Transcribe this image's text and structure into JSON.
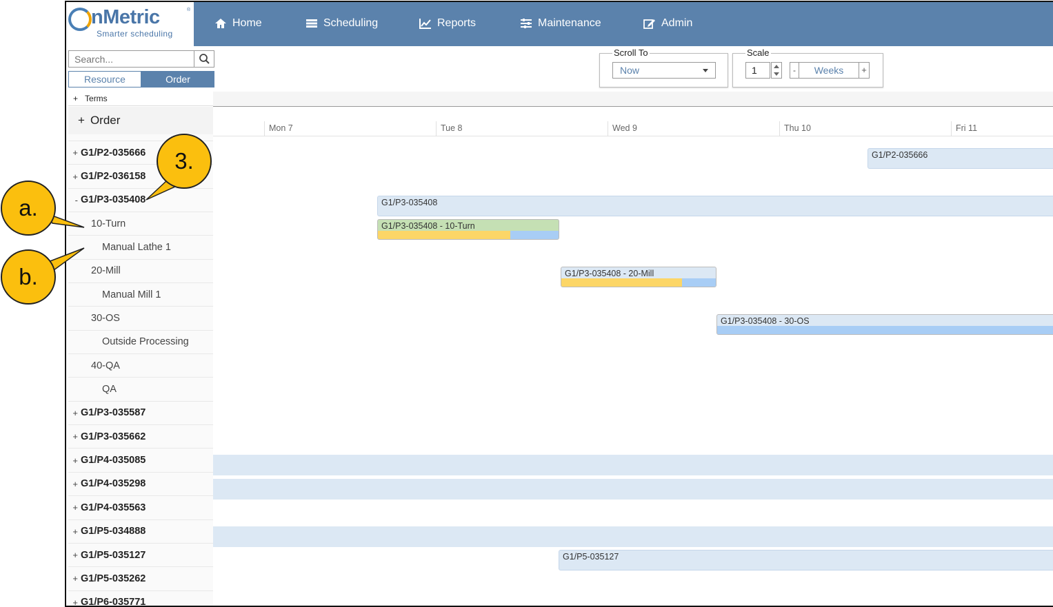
{
  "brand": {
    "name": "nMetric",
    "tagline": "Smarter scheduling",
    "reg": "®"
  },
  "nav": [
    {
      "label": "Home",
      "icon": "home-icon"
    },
    {
      "label": "Scheduling",
      "icon": "calendar-icon"
    },
    {
      "label": "Reports",
      "icon": "chart-icon"
    },
    {
      "label": "Maintenance",
      "icon": "sliders-icon"
    },
    {
      "label": "Admin",
      "icon": "edit-icon"
    }
  ],
  "sidebar": {
    "search_placeholder": "Search...",
    "toggle": {
      "resource": "Resource",
      "order": "Order",
      "active": "Order"
    },
    "terms": "Terms",
    "order_header": "Order",
    "tree": [
      {
        "kind": "order",
        "pm": "+",
        "label": "G1/P2-035666"
      },
      {
        "kind": "order",
        "pm": "+",
        "label": "G1/P2-036158"
      },
      {
        "kind": "order",
        "pm": "-",
        "label": "G1/P3-035408"
      },
      {
        "kind": "op",
        "pm": "",
        "label": "10-Turn"
      },
      {
        "kind": "res",
        "pm": "",
        "label": "Manual Lathe 1"
      },
      {
        "kind": "op",
        "pm": "",
        "label": "20-Mill"
      },
      {
        "kind": "res",
        "pm": "",
        "label": "Manual Mill 1"
      },
      {
        "kind": "op",
        "pm": "",
        "label": "30-OS"
      },
      {
        "kind": "res",
        "pm": "",
        "label": "Outside Processing"
      },
      {
        "kind": "op",
        "pm": "",
        "label": "40-QA"
      },
      {
        "kind": "res",
        "pm": "",
        "label": "QA"
      },
      {
        "kind": "order",
        "pm": "+",
        "label": "G1/P3-035587"
      },
      {
        "kind": "order",
        "pm": "+",
        "label": "G1/P3-035662"
      },
      {
        "kind": "order",
        "pm": "+",
        "label": "G1/P4-035085"
      },
      {
        "kind": "order",
        "pm": "+",
        "label": "G1/P4-035298"
      },
      {
        "kind": "order",
        "pm": "+",
        "label": "G1/P4-035563"
      },
      {
        "kind": "order",
        "pm": "+",
        "label": "G1/P5-034888"
      },
      {
        "kind": "order",
        "pm": "+",
        "label": "G1/P5-035127"
      },
      {
        "kind": "order",
        "pm": "+",
        "label": "G1/P5-035262"
      },
      {
        "kind": "order",
        "pm": "+",
        "label": "G1/P6-035771"
      }
    ]
  },
  "toolbar": {
    "scroll_to": {
      "legend": "Scroll To",
      "value": "Now"
    },
    "scale": {
      "legend": "Scale",
      "value": "1",
      "minus": "-",
      "unit": "Weeks",
      "plus": "+"
    }
  },
  "timeline": {
    "days": [
      "Mon 7",
      "Tue 8",
      "Wed 9",
      "Thu 10",
      "Fri 11"
    ],
    "bars": [
      {
        "label": "G1/P2-035666"
      },
      {
        "label": "G1/P3-035408"
      },
      {
        "label": "G1/P3-035408 - 10-Turn"
      },
      {
        "label": "G1/P3-035408 - 20-Mill"
      },
      {
        "label": "G1/P3-035408 - 30-OS"
      },
      {
        "label": "G1/P5-035127"
      }
    ]
  },
  "callouts": [
    "3.",
    "a.",
    "b."
  ],
  "colors": {
    "nav": "#5b82ac",
    "bar": "#dce8f4",
    "setup": "#fcd667",
    "run": "#a8cdf5",
    "complete": "#c5e0b4",
    "callout": "#fbbf0e"
  }
}
